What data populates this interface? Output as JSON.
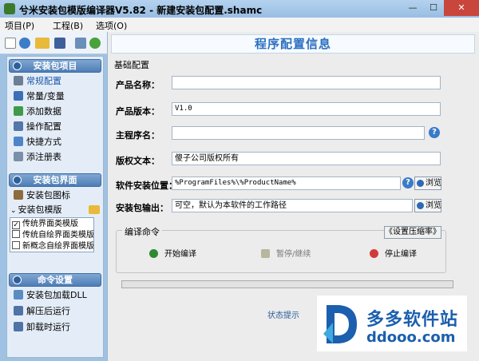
{
  "window": {
    "title": "兮米安装包模版编译器V5.82 - 新建安装包配置.shamc",
    "minimize": "—",
    "maximize": "☐",
    "close": "✕"
  },
  "menu": [
    "项目(P)",
    "工程(B)",
    "选项(O)"
  ],
  "toolbar": {
    "icons": [
      "new-file-icon",
      "globe-icon",
      "open-folder-icon",
      "save-icon",
      "build-icon",
      "run-icon"
    ]
  },
  "sidebar": {
    "project_header": "安装包项目",
    "project_items": [
      "常规配置",
      "常量/变量",
      "添加数据",
      "操作配置",
      "快捷方式",
      "添注册表"
    ],
    "ui_header": "安装包界面",
    "ui_items": [
      "安装包图标",
      "安装包模版"
    ],
    "templates": [
      {
        "label": "传统界面类模版",
        "checked": true
      },
      {
        "label": "传统自绘界面类模版",
        "checked": false
      },
      {
        "label": "新概念自绘界面模版",
        "checked": false
      }
    ],
    "cmd_header": "命令设置",
    "cmd_items": [
      "安装包加载DLL",
      "解压后运行",
      "卸载时运行"
    ]
  },
  "main": {
    "banner": "程序配置信息",
    "basic_group": "基础配置",
    "fields": {
      "product_name": {
        "label": "产品名称：",
        "value": ""
      },
      "product_version": {
        "label": "产品版本：",
        "value": "V1.0"
      },
      "main_program": {
        "label": "主程序名：",
        "value": ""
      },
      "copyright": {
        "label": "版权文本：",
        "value": "傻子公司版权所有"
      },
      "install_location": {
        "label": "软件安装位置：",
        "value": "%ProgramFiles%\\%ProductName%"
      },
      "package_output": {
        "label": "安装包输出：",
        "value": "可空，默认为本软件的工作路径"
      }
    },
    "help": "?",
    "browse": "浏览",
    "compile_group": "编译命令",
    "compress_button": "《设置压缩率》",
    "actions": {
      "start": "开始编译",
      "pause": "暂停/继续",
      "stop": "停止编译"
    },
    "progress": 0,
    "status_hint": "状态提示"
  },
  "watermark": {
    "brand": "多多软件站",
    "url": "ddooo.com"
  },
  "colors": {
    "accent": "#2c6fc0",
    "section_header": "#4e7db6",
    "window_frame": "#9fc2e3"
  }
}
